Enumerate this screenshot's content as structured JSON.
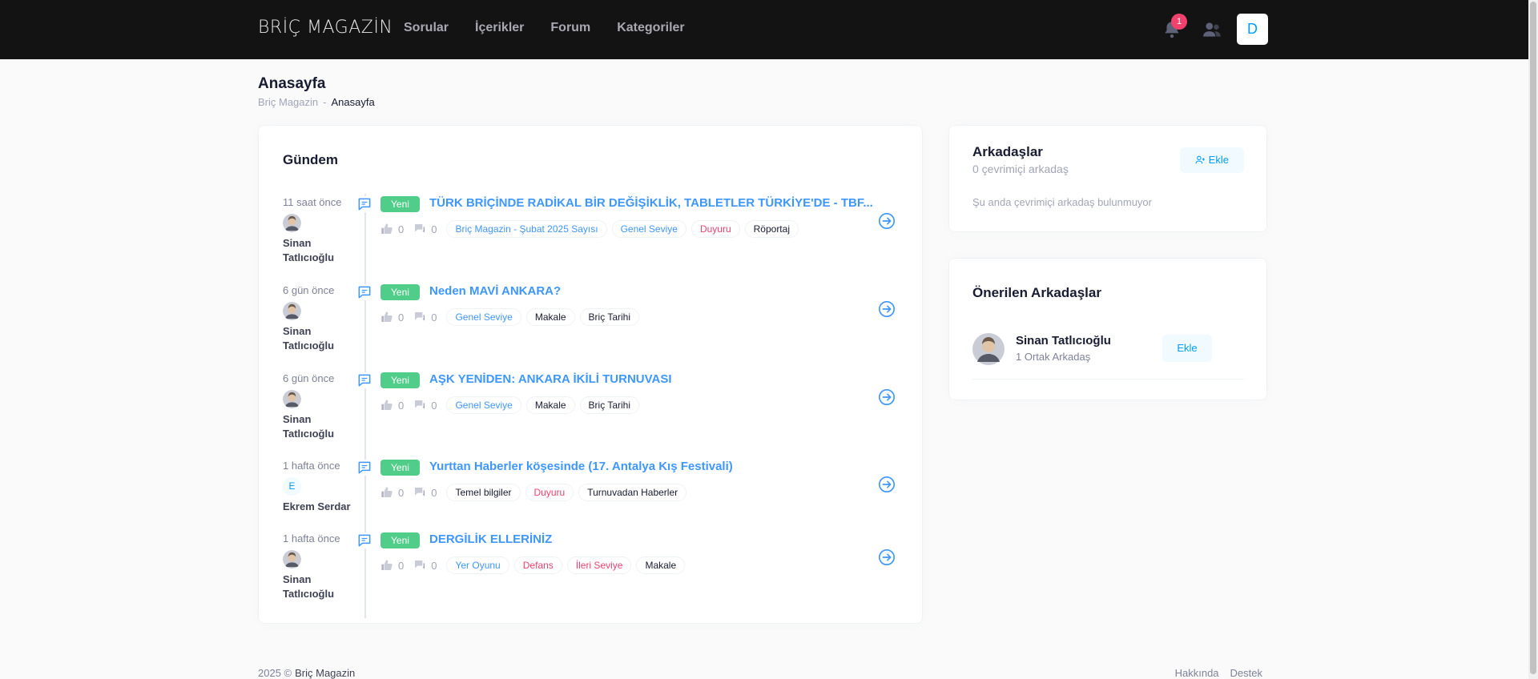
{
  "header": {
    "logo": "BRİÇ MAGAZİN",
    "nav": [
      "Sorular",
      "İçerikler",
      "Forum",
      "Kategoriler"
    ],
    "notification_count": "1",
    "user_initial": "D"
  },
  "page": {
    "title": "Anasayfa",
    "breadcrumb_root": "Briç Magazin",
    "breadcrumb_sep": "-",
    "breadcrumb_current": "Anasayfa"
  },
  "feed": {
    "title": "Gündem",
    "items": [
      {
        "time": "11 saat önce",
        "author_line1": "Sinan",
        "author_line2": "Tatlıcıoğlu",
        "badge": "Yeni",
        "title": "TÜRK BRİÇİNDE RADİKAL BİR DEĞİŞİKLİK, TABLETLER TÜRKİYE'DE - TBF...",
        "likes": "0",
        "comments": "0",
        "tags": [
          {
            "label": "Briç Magazin - Şubat 2025 Sayısı",
            "tone": "blue"
          },
          {
            "label": "Genel Seviye",
            "tone": "blue"
          },
          {
            "label": "Duyuru",
            "tone": "red"
          },
          {
            "label": "Röportaj",
            "tone": "dark"
          }
        ]
      },
      {
        "time": "6 gün önce",
        "author_line1": "Sinan",
        "author_line2": "Tatlıcıoğlu",
        "badge": "Yeni",
        "title": "Neden MAVİ ANKARA?",
        "likes": "0",
        "comments": "0",
        "tags": [
          {
            "label": "Genel Seviye",
            "tone": "blue"
          },
          {
            "label": "Makale",
            "tone": "dark"
          },
          {
            "label": "Briç Tarihi",
            "tone": "dark"
          }
        ]
      },
      {
        "time": "6 gün önce",
        "author_line1": "Sinan",
        "author_line2": "Tatlıcıoğlu",
        "badge": "Yeni",
        "title": "AŞK YENİDEN: ANKARA İKİLİ TURNUVASI",
        "likes": "0",
        "comments": "0",
        "tags": [
          {
            "label": "Genel Seviye",
            "tone": "blue"
          },
          {
            "label": "Makale",
            "tone": "dark"
          },
          {
            "label": "Briç Tarihi",
            "tone": "dark"
          }
        ]
      },
      {
        "time": "1 hafta önce",
        "avatar_letter": "E",
        "author_line1": "Ekrem Serdar",
        "author_line2": "",
        "badge": "Yeni",
        "title": "Yurttan Haberler köşesinde (17. Antalya Kış Festivali)",
        "likes": "0",
        "comments": "0",
        "tags": [
          {
            "label": "Temel bilgiler",
            "tone": "dark"
          },
          {
            "label": "Duyuru",
            "tone": "red"
          },
          {
            "label": "Turnuvadan Haberler",
            "tone": "dark"
          }
        ]
      },
      {
        "time": "1 hafta önce",
        "author_line1": "Sinan",
        "author_line2": "Tatlıcıoğlu",
        "badge": "Yeni",
        "title": "DERGİLİK ELLERİNİZ",
        "likes": "0",
        "comments": "0",
        "tags": [
          {
            "label": "Yer Oyunu",
            "tone": "blue"
          },
          {
            "label": "Defans",
            "tone": "red"
          },
          {
            "label": "İleri Seviye",
            "tone": "red"
          },
          {
            "label": "Makale",
            "tone": "dark"
          }
        ]
      }
    ]
  },
  "friends": {
    "title": "Arkadaşlar",
    "online_count": "0 çevrimiçi arkadaş",
    "add_label": "Ekle",
    "empty": "Şu anda çevrimiçi arkadaş bulunmuyor"
  },
  "suggested": {
    "title": "Önerilen Arkadaşlar",
    "name": "Sinan Tatlıcıoğlu",
    "mutual": "1 Ortak Arkadaş",
    "add_label": "Ekle"
  },
  "footer": {
    "year": "2025 ©",
    "brand": "Briç Magazin",
    "about": "Hakkında",
    "support": "Destek"
  }
}
